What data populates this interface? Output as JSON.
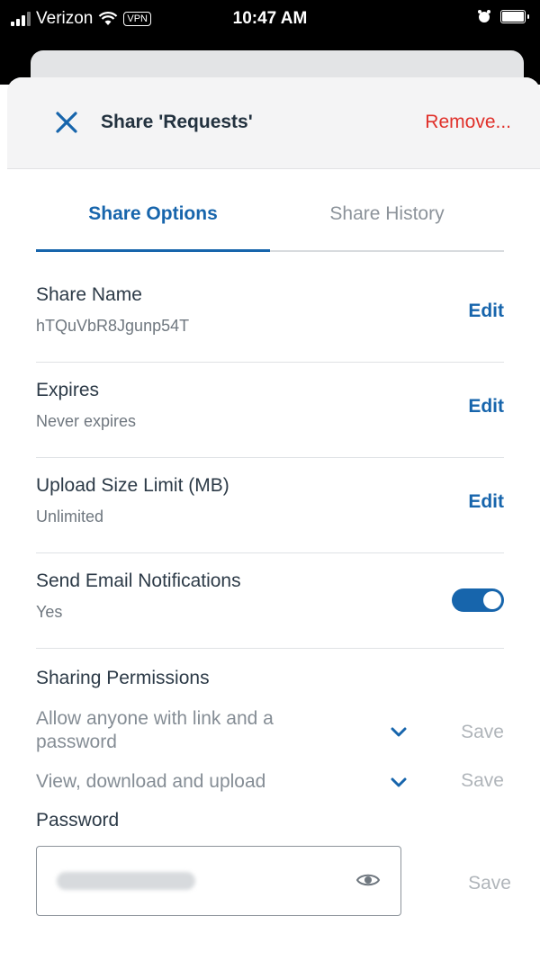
{
  "status_bar": {
    "carrier": "Verizon",
    "vpn": "VPN",
    "time": "10:47 AM"
  },
  "header": {
    "title": "Share 'Requests'",
    "remove_label": "Remove..."
  },
  "tabs": [
    {
      "label": "Share Options",
      "active": true
    },
    {
      "label": "Share History",
      "active": false
    }
  ],
  "settings": [
    {
      "label": "Share Name",
      "value": "hTQuVbR8Jgunp54T",
      "action": "Edit"
    },
    {
      "label": "Expires",
      "value": "Never expires",
      "action": "Edit"
    },
    {
      "label": "Upload Size Limit (MB)",
      "value": "Unlimited",
      "action": "Edit"
    },
    {
      "label": "Send Email Notifications",
      "value": "Yes",
      "toggle_on": true
    }
  ],
  "permissions": {
    "title": "Sharing Permissions",
    "access": {
      "value": "Allow anyone with link and a password",
      "save_label": "Save"
    },
    "rights": {
      "value": "View, download and upload",
      "save_label": "Save"
    }
  },
  "password": {
    "label": "Password",
    "save_label": "Save"
  },
  "colors": {
    "accent": "#1765ac",
    "danger": "#e0302a"
  }
}
